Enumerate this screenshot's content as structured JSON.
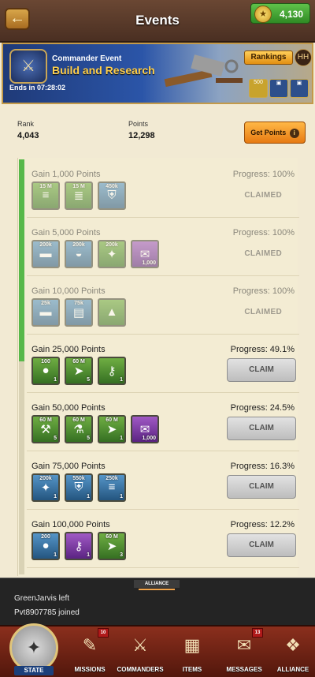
{
  "header": {
    "title": "Events",
    "back_icon": "back-arrow-icon",
    "currency_value": "4,130",
    "currency_icon": "eagle-coin-icon"
  },
  "banner": {
    "subtitle": "Commander Event",
    "title": "Build and Research",
    "timer": "Ends in 07:28:02",
    "rankings_label": "Rankings",
    "rank_icon_text": "HH",
    "mini_rewards": [
      {
        "label": "500",
        "icon": "coin-icon"
      },
      {
        "label": "",
        "icon": "chest-icon"
      },
      {
        "label": "",
        "icon": "chest-icon"
      }
    ]
  },
  "stats": {
    "rank_label": "Rank",
    "rank_value": "4,043",
    "points_label": "Points",
    "points_value": "12,298",
    "get_points_label": "Get Points",
    "info_glyph": "i"
  },
  "milestones": [
    {
      "gain": "Gain 1,000 Points",
      "progress": "Progress: 100%",
      "status": "CLAIMED",
      "items": [
        {
          "top": "15 M",
          "bot": "",
          "color": "green",
          "icon": "wood-icon"
        },
        {
          "top": "15 M",
          "bot": "",
          "color": "green",
          "icon": "lumber-icon"
        },
        {
          "top": "450k",
          "bot": "",
          "color": "blue",
          "icon": "shield-icon"
        }
      ]
    },
    {
      "gain": "Gain 5,000 Points",
      "progress": "Progress: 100%",
      "status": "CLAIMED",
      "items": [
        {
          "top": "200k",
          "bot": "",
          "color": "blue",
          "icon": "steel-icon"
        },
        {
          "top": "200k",
          "bot": "",
          "color": "blue",
          "icon": "food-icon"
        },
        {
          "top": "200k",
          "bot": "",
          "color": "green",
          "icon": "medal-icon"
        },
        {
          "top": "",
          "bot": "1,000",
          "color": "purple",
          "icon": "scroll-icon"
        }
      ]
    },
    {
      "gain": "Gain 10,000 Points",
      "progress": "Progress: 100%",
      "status": "CLAIMED",
      "items": [
        {
          "top": "25k",
          "bot": "",
          "color": "blue",
          "icon": "steel-icon"
        },
        {
          "top": "75k",
          "bot": "",
          "color": "blue",
          "icon": "cash-icon"
        },
        {
          "top": "",
          "bot": "",
          "color": "green",
          "icon": "tent-icon"
        }
      ]
    },
    {
      "gain": "Gain 25,000 Points",
      "progress": "Progress: 49.1%",
      "status": "CLAIM",
      "items": [
        {
          "top": "100",
          "bot": "1",
          "color": "green",
          "icon": "coin-icon"
        },
        {
          "top": "60 M",
          "bot": "5",
          "color": "green",
          "icon": "speedup-icon"
        },
        {
          "top": "",
          "bot": "1",
          "color": "green",
          "icon": "key-icon"
        }
      ]
    },
    {
      "gain": "Gain 50,000 Points",
      "progress": "Progress: 24.5%",
      "status": "CLAIM",
      "items": [
        {
          "top": "60 M",
          "bot": "5",
          "color": "green",
          "icon": "build-speedup-icon"
        },
        {
          "top": "60 M",
          "bot": "5",
          "color": "green",
          "icon": "research-speedup-icon"
        },
        {
          "top": "60 M",
          "bot": "1",
          "color": "green",
          "icon": "speedup-icon"
        },
        {
          "top": "",
          "bot": "1,000",
          "color": "purple",
          "icon": "scroll-icon"
        }
      ]
    },
    {
      "gain": "Gain 75,000 Points",
      "progress": "Progress: 16.3%",
      "status": "CLAIM",
      "items": [
        {
          "top": "200k",
          "bot": "1",
          "color": "blue",
          "icon": "medal-icon"
        },
        {
          "top": "550k",
          "bot": "1",
          "color": "blue",
          "icon": "shield-icon"
        },
        {
          "top": "250k",
          "bot": "1",
          "color": "blue",
          "icon": "wood-icon"
        }
      ]
    },
    {
      "gain": "Gain 100,000 Points",
      "progress": "Progress: 12.2%",
      "status": "CLAIM",
      "items": [
        {
          "top": "200",
          "bot": "1",
          "color": "blue",
          "icon": "coin-icon"
        },
        {
          "top": "",
          "bot": "1",
          "color": "purple",
          "icon": "key-icon"
        },
        {
          "top": "60 M",
          "bot": "3",
          "color": "green",
          "icon": "speedup-icon"
        }
      ]
    }
  ],
  "chat": {
    "tab_label": "ALLIANCE",
    "lines": [
      "GreenJarvis left",
      "Pvt8907785 joined"
    ]
  },
  "nav": [
    {
      "label": "STATE",
      "icon": "eagle-icon",
      "badge": ""
    },
    {
      "label": "MISSIONS",
      "icon": "quill-icon",
      "badge": "10"
    },
    {
      "label": "COMMANDERS",
      "icon": "crossed-rifles-icon",
      "badge": ""
    },
    {
      "label": "ITEMS",
      "icon": "crate-icon",
      "badge": ""
    },
    {
      "label": "MESSAGES",
      "icon": "mailbox-icon",
      "badge": "13"
    },
    {
      "label": "ALLIANCE",
      "icon": "alliance-eagle-icon",
      "badge": ""
    }
  ]
}
